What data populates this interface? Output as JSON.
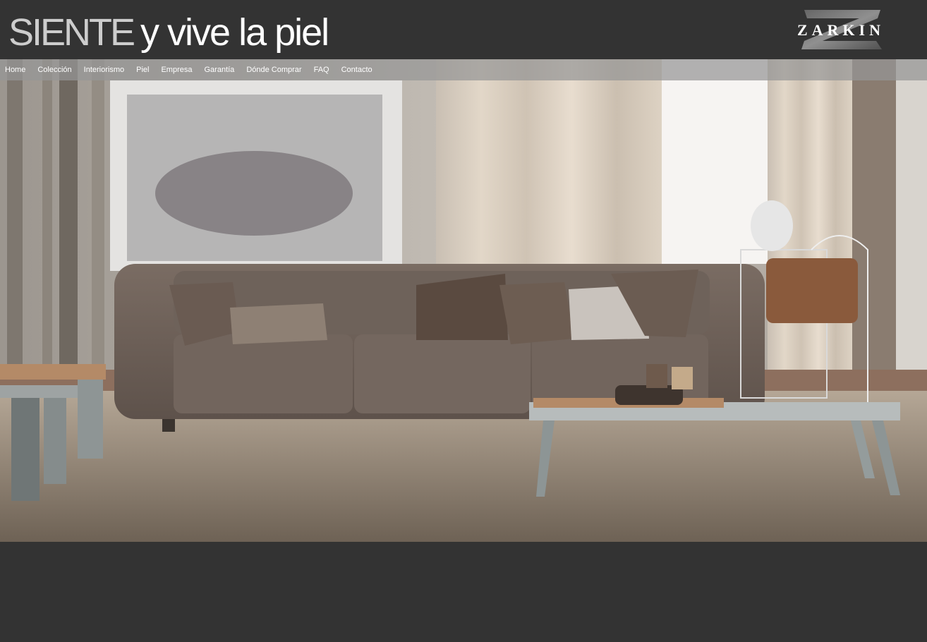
{
  "header": {
    "tagline_light": "SIENTE",
    "tagline_regular": "y vive la piel",
    "logo_text": "ZARKIN",
    "logo_mark": "Z"
  },
  "nav": {
    "items": [
      {
        "label": "Home"
      },
      {
        "label": "Colección"
      },
      {
        "label": "Interiorismo"
      },
      {
        "label": "Piel"
      },
      {
        "label": "Empresa"
      },
      {
        "label": "Garantía"
      },
      {
        "label": "Dónde Comprar"
      },
      {
        "label": "FAQ"
      },
      {
        "label": "Contacto"
      }
    ]
  },
  "hero": {
    "image": "leather-sofa-living-room-photo"
  },
  "colors": {
    "background": "#333333",
    "nav_overlay": "#969696",
    "text": "#ffffff"
  }
}
